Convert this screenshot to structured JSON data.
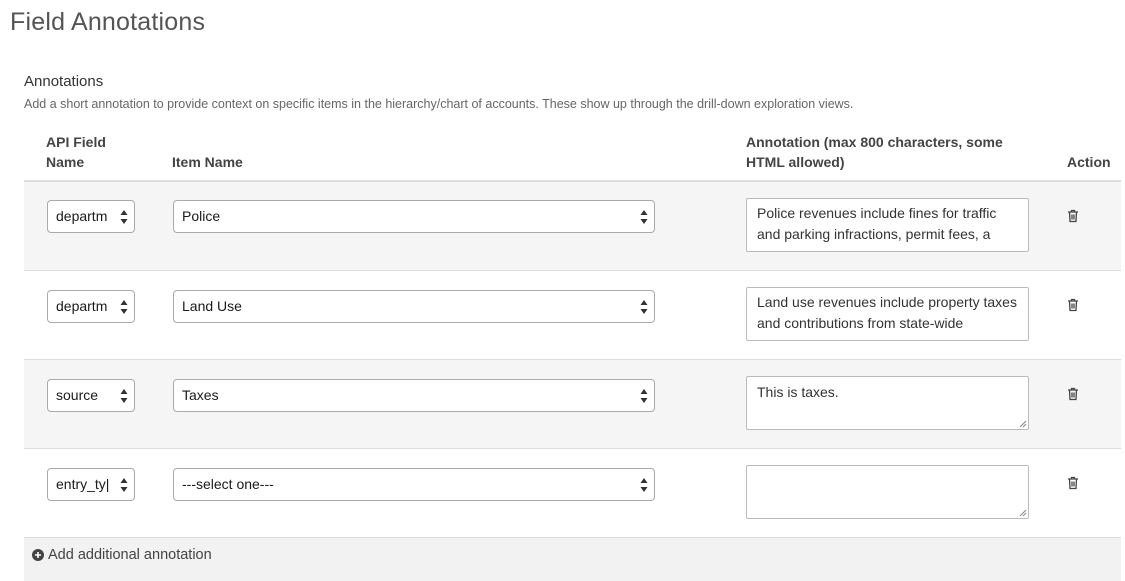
{
  "page": {
    "title": "Field Annotations"
  },
  "section": {
    "title": "Annotations",
    "description": "Add a short annotation to provide context on specific items in the hierarchy/chart of accounts. These show up through the drill-down exploration views."
  },
  "table": {
    "headers": {
      "api_field_line1": "API Field",
      "api_field_line2": "Name",
      "item_name": "Item Name",
      "annotation_line1": "Annotation (max 800 characters, some",
      "annotation_line2": "HTML allowed)",
      "action": "Action"
    },
    "rows": [
      {
        "api_field": "departm",
        "item_name": "Police",
        "annotation": "Police revenues include fines for traffic and parking infractions, permit fees, a"
      },
      {
        "api_field": "departm",
        "item_name": "Land Use",
        "annotation": "Land use revenues include property taxes and contributions from state-wide"
      },
      {
        "api_field": "source",
        "item_name": "Taxes",
        "annotation": "This is taxes."
      },
      {
        "api_field": "entry_ty|",
        "item_name": "---select one---",
        "annotation": ""
      }
    ]
  },
  "footer": {
    "add_label": "Add additional annotation"
  },
  "colors": {
    "border": "#aaaaaa",
    "row_alt": "#f5f5f5",
    "footer_bg": "#f2f2f2",
    "text": "#333333"
  },
  "icons": {
    "select_arrows": "up-down-arrows-icon",
    "delete": "trash-icon",
    "add": "plus-circle-icon"
  }
}
